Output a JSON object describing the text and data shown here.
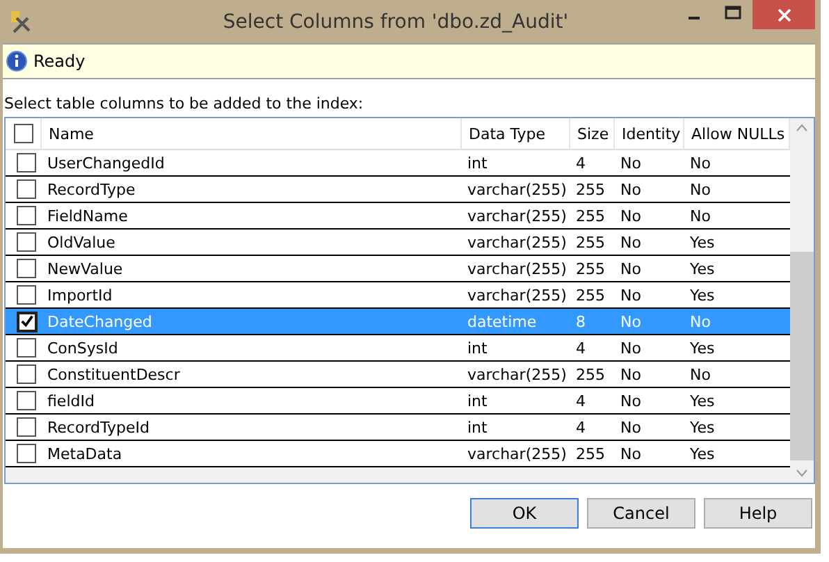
{
  "window": {
    "title": "Select Columns from 'dbo.zd_Audit'"
  },
  "status": {
    "text": "Ready"
  },
  "instruction": "Select table columns to be added to the index:",
  "table": {
    "select_all_checked": false,
    "columns": [
      "Name",
      "Data Type",
      "Size",
      "Identity",
      "Allow NULLs"
    ],
    "rows": [
      {
        "checked": false,
        "selected": false,
        "cells": [
          "UserChangedId",
          "int",
          "4",
          "No",
          "No"
        ]
      },
      {
        "checked": false,
        "selected": false,
        "cells": [
          "RecordType",
          "varchar(255)",
          "255",
          "No",
          "No"
        ]
      },
      {
        "checked": false,
        "selected": false,
        "cells": [
          "FieldName",
          "varchar(255)",
          "255",
          "No",
          "No"
        ]
      },
      {
        "checked": false,
        "selected": false,
        "cells": [
          "OldValue",
          "varchar(255)",
          "255",
          "No",
          "Yes"
        ]
      },
      {
        "checked": false,
        "selected": false,
        "cells": [
          "NewValue",
          "varchar(255)",
          "255",
          "No",
          "Yes"
        ]
      },
      {
        "checked": false,
        "selected": false,
        "cells": [
          "ImportId",
          "varchar(255)",
          "255",
          "No",
          "Yes"
        ]
      },
      {
        "checked": true,
        "selected": true,
        "cells": [
          "DateChanged",
          "datetime",
          "8",
          "No",
          "No"
        ]
      },
      {
        "checked": false,
        "selected": false,
        "cells": [
          "ConSysId",
          "int",
          "4",
          "No",
          "Yes"
        ]
      },
      {
        "checked": false,
        "selected": false,
        "cells": [
          "ConstituentDescr",
          "varchar(255)",
          "255",
          "No",
          "No"
        ]
      },
      {
        "checked": false,
        "selected": false,
        "cells": [
          "fieldId",
          "int",
          "4",
          "No",
          "Yes"
        ]
      },
      {
        "checked": false,
        "selected": false,
        "cells": [
          "RecordTypeId",
          "int",
          "4",
          "No",
          "Yes"
        ]
      },
      {
        "checked": false,
        "selected": false,
        "cells": [
          "MetaData",
          "varchar(255)",
          "255",
          "No",
          "Yes"
        ]
      }
    ]
  },
  "buttons": [
    {
      "label": "OK",
      "selected": true
    },
    {
      "label": "Cancel",
      "selected": false
    },
    {
      "label": "Help",
      "selected": false
    }
  ]
}
